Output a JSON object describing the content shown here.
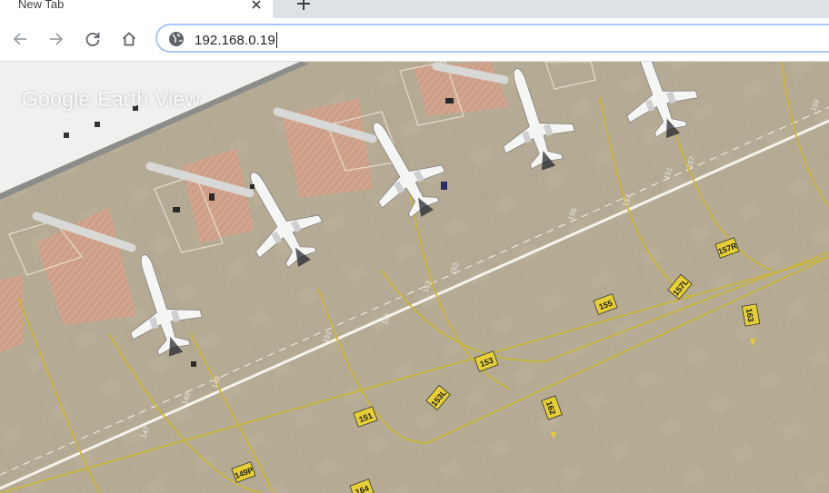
{
  "tab": {
    "title": "New Tab",
    "close_icon": "close-icon"
  },
  "newtab": {
    "icon": "plus-icon"
  },
  "toolbar": {
    "back_icon": "arrow-left-icon",
    "forward_icon": "arrow-right-icon",
    "reload_icon": "reload-icon",
    "home_icon": "home-icon"
  },
  "omnibox": {
    "site_icon": "globe-icon",
    "url": "192.168.0.19"
  },
  "content": {
    "brand_google": "Google",
    "brand_earth": "Earth View",
    "stand_markers": [
      "149P",
      "151",
      "153",
      "153L",
      "155",
      "157L",
      "157R",
      "162",
      "163",
      "164",
      "155"
    ]
  },
  "colors": {
    "tabstrip": "#dee1e6",
    "omnibox_border": "#a8c7fa",
    "tarmac": "#b4aa93",
    "taxi_line": "#c9b53a",
    "marker": "#e6cf35"
  }
}
